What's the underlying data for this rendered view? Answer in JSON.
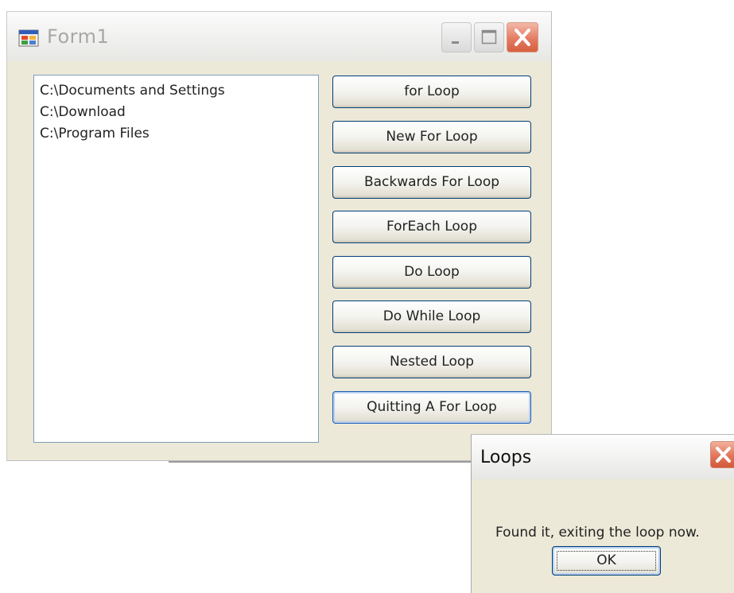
{
  "form": {
    "title": "Form1",
    "icons": {
      "app": "windows-form-icon",
      "minimize": "minimize-icon",
      "maximize": "maximize-icon",
      "close": "close-icon"
    },
    "listbox": {
      "items": [
        "C:\\Documents and Settings",
        "C:\\Download",
        "C:\\Program Files"
      ]
    },
    "buttons": [
      "for Loop",
      "New For Loop",
      "Backwards For Loop",
      "ForEach Loop",
      "Do Loop",
      "Do While Loop",
      "Nested Loop",
      "Quitting A For Loop"
    ]
  },
  "dialog": {
    "title": "Loops",
    "message": "Found it, exiting the loop now.",
    "ok_label": "OK",
    "icons": {
      "close": "close-icon"
    }
  },
  "colors": {
    "window_face": "#ece9d8",
    "button_border": "#003c74",
    "close_red": "#e37c62",
    "listbox_border": "#7f9db9"
  }
}
